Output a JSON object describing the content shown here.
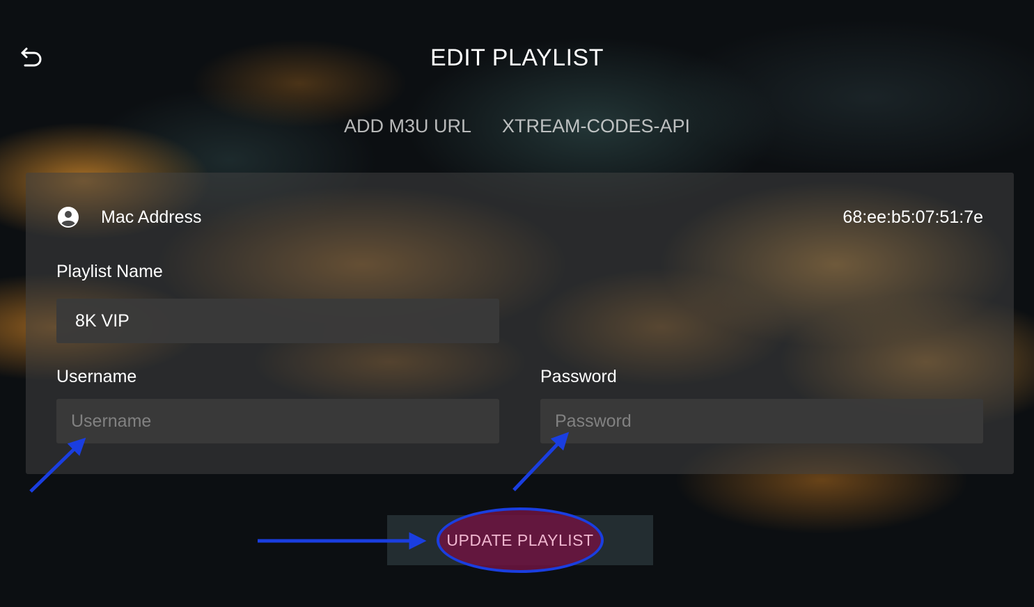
{
  "header": {
    "back_icon": "back-arrow-icon",
    "title": "EDIT PLAYLIST"
  },
  "tabs": [
    {
      "label": "ADD M3U URL",
      "active": false
    },
    {
      "label": "XTREAM-CODES-API",
      "active": true
    }
  ],
  "form": {
    "mac": {
      "icon": "account-circle-icon",
      "label": "Mac Address",
      "value": "68:ee:b5:07:51:7e"
    },
    "playlist_name": {
      "label": "Playlist Name",
      "value": "8K VIP"
    },
    "username": {
      "label": "Username",
      "value": "",
      "placeholder": "Username"
    },
    "password": {
      "label": "Password",
      "value": "",
      "placeholder": "Password"
    }
  },
  "actions": {
    "update_label": "UPDATE PLAYLIST"
  },
  "colors": {
    "annotation_arrow": "#1a3ee0",
    "button_highlight": "#6e1441",
    "button_text": "#f0b7d0"
  }
}
